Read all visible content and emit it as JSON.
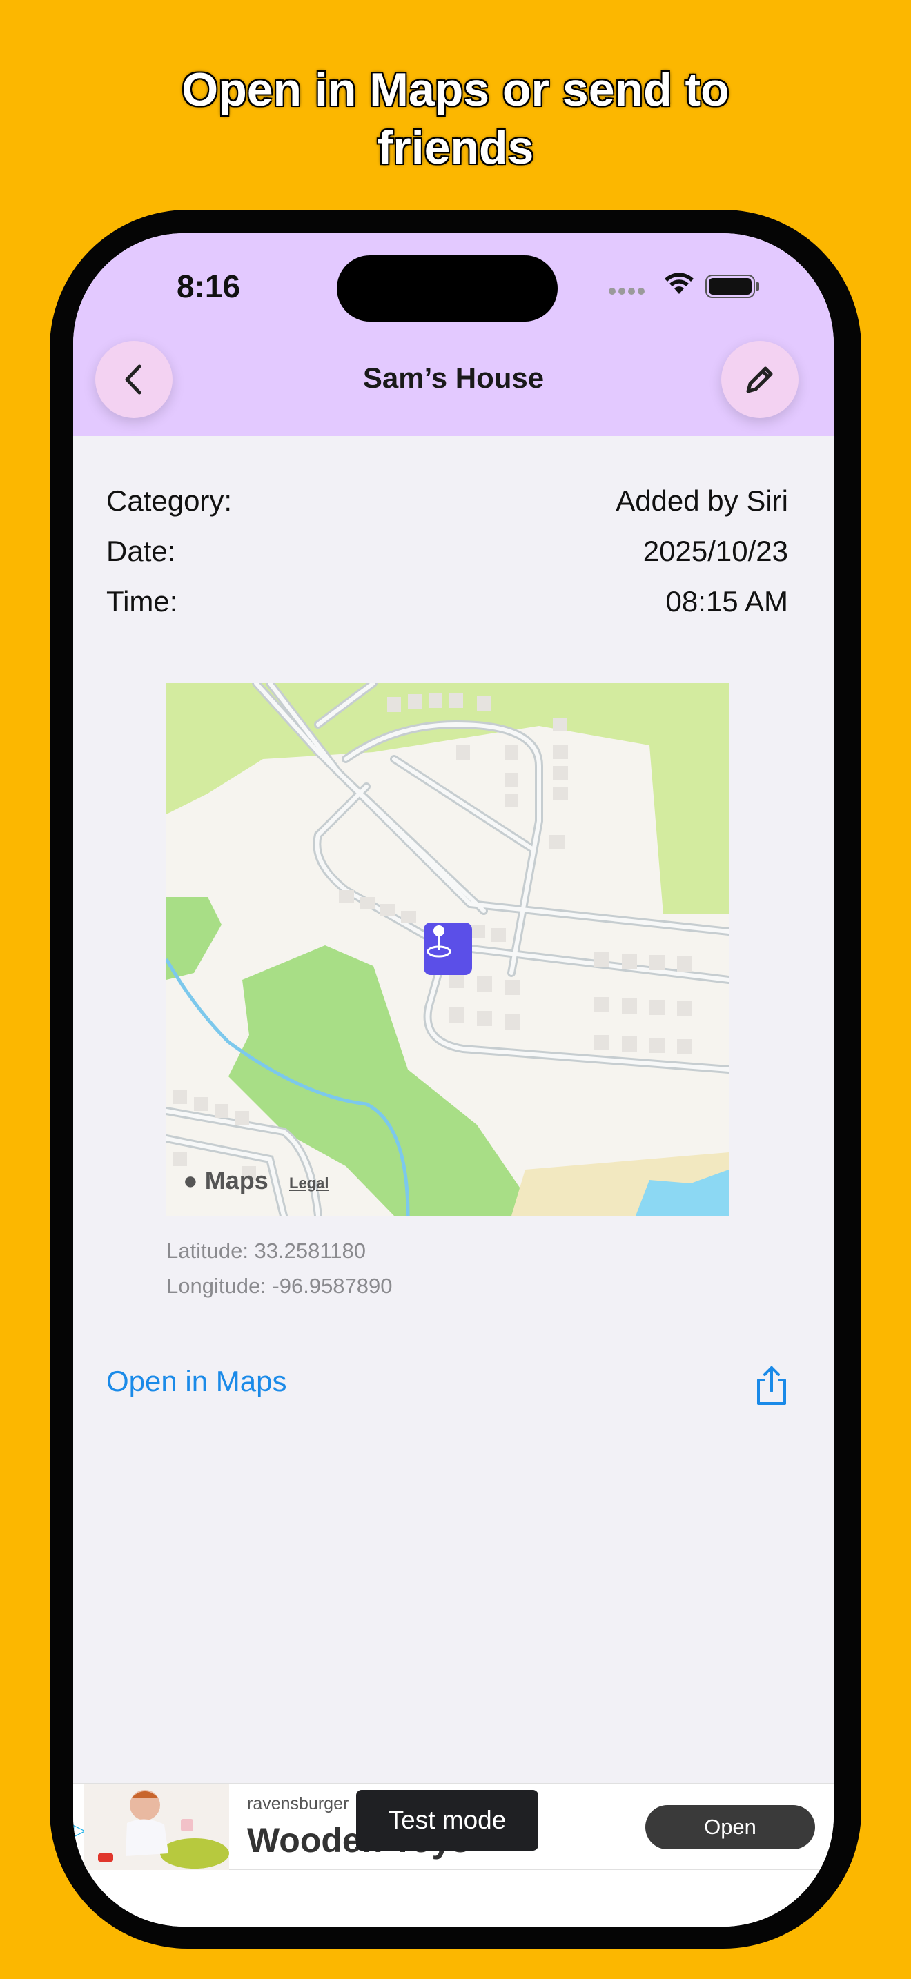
{
  "headline": {
    "line1": "Open in Maps or send to",
    "line2": "friends"
  },
  "status_bar": {
    "time": "8:16",
    "icons": [
      "cellular-signal-icon",
      "wifi-icon",
      "battery-icon"
    ]
  },
  "nav": {
    "title": "Sam’s House",
    "back_icon": "chevron-left-icon",
    "edit_icon": "pencil-icon",
    "background": "#E3C9FF"
  },
  "details": {
    "category_label": "Category:",
    "category_value": "Added by Siri",
    "date_label": "Date:",
    "date_value": "2025/10/23",
    "time_label": "Time:",
    "time_value": "08:15 AM"
  },
  "map": {
    "logo_text": "Maps",
    "legal_label": "Legal",
    "pin_icon": "map-pin-icon",
    "pin_color": "#5B4FE8"
  },
  "coordinates": {
    "latitude": "Latitude: 33.2581180",
    "longitude": "Longitude: -96.9587890"
  },
  "actions": {
    "open_in_maps": "Open in Maps",
    "share_icon": "share-icon",
    "link_color": "#1A8AE8"
  },
  "ad": {
    "brand": "ravensburger",
    "title": "Wooden Toys",
    "test_mode_label": "Test mode",
    "open_label": "Open"
  },
  "colors": {
    "background": "#FCB700",
    "accent": "#1A8AE8"
  }
}
